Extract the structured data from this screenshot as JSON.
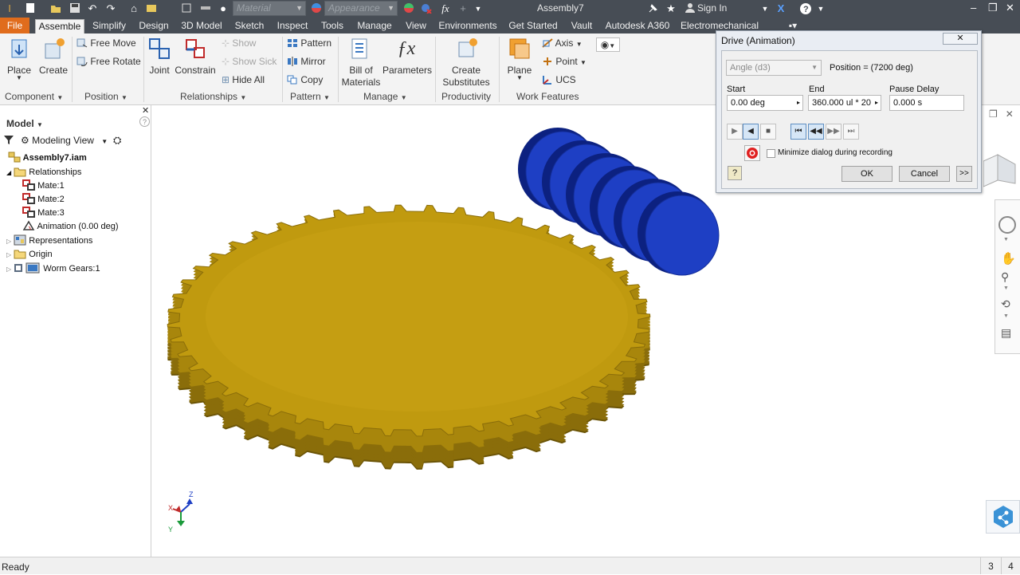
{
  "titlebar": {
    "material_placeholder": "Material",
    "appearance_placeholder": "Appearance",
    "fx_label": "fx",
    "app_title": "Assembly7",
    "sign_in": "Sign In"
  },
  "tabs": [
    {
      "label": "File"
    },
    {
      "label": "Assemble"
    },
    {
      "label": "Simplify"
    },
    {
      "label": "Design"
    },
    {
      "label": "3D Model"
    },
    {
      "label": "Sketch"
    },
    {
      "label": "Inspect"
    },
    {
      "label": "Tools"
    },
    {
      "label": "Manage"
    },
    {
      "label": "View"
    },
    {
      "label": "Environments"
    },
    {
      "label": "Get Started"
    },
    {
      "label": "Vault"
    },
    {
      "label": "Autodesk A360"
    },
    {
      "label": "Electromechanical"
    }
  ],
  "ribbon": {
    "place": "Place",
    "create": "Create",
    "free_move": "Free Move",
    "free_rotate": "Free Rotate",
    "joint": "Joint",
    "constrain": "Constrain",
    "show": "Show",
    "show_sick": "Show Sick",
    "hide_all": "Hide All",
    "pattern": "Pattern",
    "mirror": "Mirror",
    "copy": "Copy",
    "bom_line1": "Bill of",
    "bom_line2": "Materials",
    "parameters": "Parameters",
    "create_sub_line1": "Create",
    "create_sub_line2": "Substitutes",
    "plane": "Plane",
    "axis": "Axis",
    "point": "Point",
    "ucs": "UCS",
    "panels": {
      "component": "Component",
      "position": "Position",
      "relationships": "Relationships",
      "pattern": "Pattern",
      "manage": "Manage",
      "productivity": "Productivity",
      "work_features": "Work Features"
    }
  },
  "browser": {
    "header": "Model",
    "view": "Modeling View",
    "items": [
      {
        "label": "Assembly7.iam"
      },
      {
        "label": "Relationships"
      },
      {
        "label": "Mate:1"
      },
      {
        "label": "Mate:2"
      },
      {
        "label": "Mate:3"
      },
      {
        "label": "Animation (0.00 deg)"
      },
      {
        "label": "Representations"
      },
      {
        "label": "Origin"
      },
      {
        "label": "Worm Gears:1"
      }
    ]
  },
  "dialog": {
    "title": "Drive (Animation)",
    "constraint_select": "Angle (d3)",
    "position": "Position = (7200 deg)",
    "start_label": "Start",
    "start_value": "0.00 deg",
    "end_label": "End",
    "end_value": "360.000 ul * 20",
    "pause_label": "Pause Delay",
    "pause_value": "0.000 s",
    "minimize_label": "Minimize dialog during recording",
    "minimize_checked": false,
    "ok": "OK",
    "cancel": "Cancel",
    "expand": ">>"
  },
  "axes": {
    "x": "X",
    "y": "Y",
    "z": "Z"
  },
  "status": {
    "text": "Ready",
    "count1": "3",
    "count2": "4"
  },
  "colors": {
    "gear": "#c09a0f",
    "gear_dark": "#6b5406",
    "worm": "#1e3fc4",
    "worm_dark": "#0c2180",
    "file_tab": "#e06c1c",
    "titlebar": "#474d55"
  }
}
